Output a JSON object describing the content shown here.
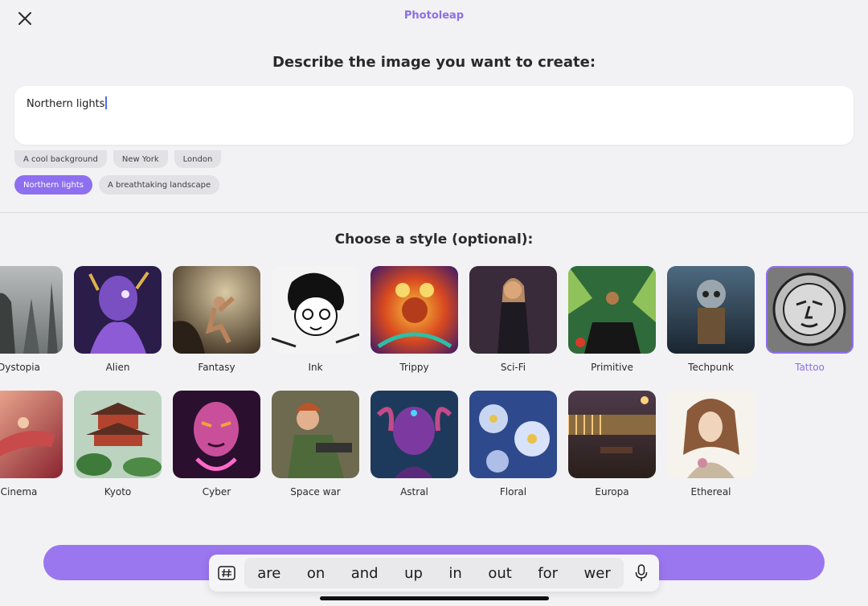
{
  "header": {
    "app_title": "Photoleap",
    "prompt_heading": "Describe the image you want to create:"
  },
  "prompt": {
    "value": "Northern lights"
  },
  "suggestions": {
    "row1": [
      "A cool background",
      "New York",
      "London"
    ],
    "row2": [
      "Northern lights",
      "A breathtaking landscape"
    ],
    "active": "Northern lights"
  },
  "styles": {
    "heading": "Choose a style (optional):",
    "selected": "Tattoo",
    "row1": [
      "Dystopia",
      "Alien",
      "Fantasy",
      "Ink",
      "Trippy",
      "Sci-Fi",
      "Primitive",
      "Techpunk",
      "Tattoo"
    ],
    "row2": [
      "Cinema",
      "Kyoto",
      "Cyber",
      "Space war",
      "Astral",
      "Floral",
      "Europa",
      "Ethereal"
    ]
  },
  "keyboard": {
    "suggestions": [
      "are",
      "on",
      "and",
      "up",
      "in",
      "out",
      "for",
      "wer"
    ]
  },
  "colors": {
    "accent": "#8e6ff0",
    "generate_button": "#9a76ef",
    "background": "#f2f2f4"
  },
  "icons": {
    "close": "close-icon",
    "keyboard_hashtag": "hashtag-icon",
    "dictation": "microphone-icon"
  }
}
